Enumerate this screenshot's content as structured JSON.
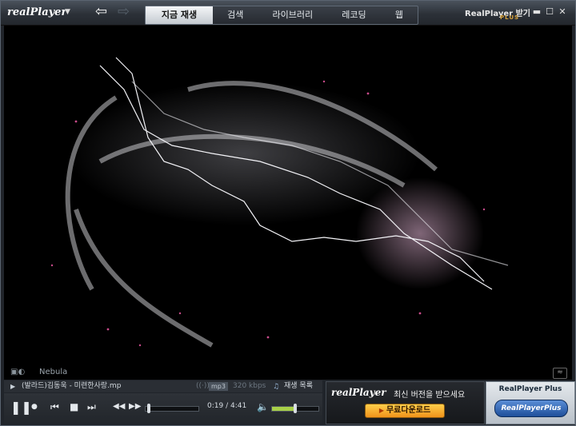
{
  "app": {
    "logo_text": "realPlayer",
    "brand_label": "RealPlayer 받기",
    "brand_plus": "PLUS"
  },
  "nav": {
    "back_icon": "arrow-left-icon",
    "forward_icon": "arrow-right-icon"
  },
  "tabs": [
    {
      "label": "지금 재생",
      "active": true
    },
    {
      "label": "검색",
      "active": false
    },
    {
      "label": "라이브러리",
      "active": false
    },
    {
      "label": "레코딩",
      "active": false
    },
    {
      "label": "웹",
      "active": false
    }
  ],
  "video": {
    "visualization_name": "Nebula"
  },
  "track": {
    "title": "(발라드)김동욱 - 미련한사랑.mp",
    "format": "mp3",
    "bitrate": "320 kbps",
    "playlist_label": "재생 목록"
  },
  "playback": {
    "time_display": "0:19 / 4:41",
    "progress_fraction": 0.068,
    "volume_fraction": 0.5
  },
  "ad": {
    "logo_text": "realPlayer",
    "message": "최신 버전을 받으세요",
    "button_label": "무료다운로드"
  },
  "plus_panel": {
    "title": "RealPlayer Plus",
    "button_label": "RealPlayerPlus"
  },
  "colors": {
    "accent_orange": "#f0a020",
    "volume_green": "#a8d048",
    "tab_active_bg": "#e8ecef"
  }
}
